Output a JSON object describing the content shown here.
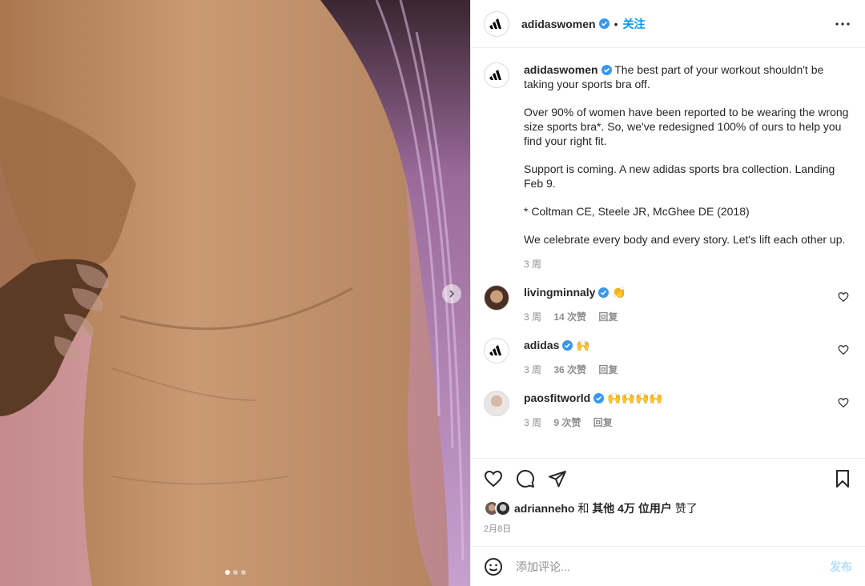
{
  "post": {
    "username": "adidaswomen",
    "follow_label": "关注",
    "dot_separator": "•"
  },
  "caption": {
    "username": "adidaswomen",
    "first_line": "The best part of your workout shouldn't be taking your sports bra off.",
    "paragraphs": [
      "Over 90% of women have been reported to be wearing the wrong size sports bra*. So, we've redesigned 100% of ours to help you find your right fit.",
      "Support is coming. A new adidas sports bra collection. Landing Feb 9.",
      "* Coltman CE, Steele JR, McGhee DE (2018)",
      "We celebrate every body and every story. Let's lift each other up."
    ],
    "time": "3 周"
  },
  "comments": [
    {
      "username": "livingminnaly",
      "text": "👏",
      "time": "3 周",
      "likes": "14 次赞",
      "reply": "回复"
    },
    {
      "username": "adidas",
      "text": "🙌",
      "time": "3 周",
      "likes": "36 次赞",
      "reply": "回复"
    },
    {
      "username": "paosfitworld",
      "text": "🙌🙌🙌🙌",
      "time": "3 周",
      "likes": "9 次赞",
      "reply": "回复"
    }
  ],
  "likes": {
    "user": "adrianneho",
    "joiner": "和",
    "others": "其他 4万 位用户",
    "suffix": "赞了"
  },
  "date": "2月8日",
  "add_comment": {
    "placeholder": "添加评论...",
    "post_label": "发布"
  },
  "carousel": {
    "count": 3,
    "active_index": 0
  },
  "colors": {
    "accent": "#0095f6",
    "verified": "#3897f0",
    "muted": "#8e8e8e",
    "post_disabled": "#b2dffc"
  }
}
